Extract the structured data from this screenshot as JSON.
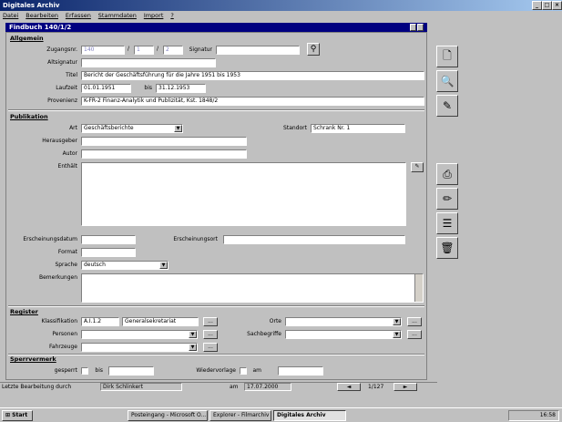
{
  "app_title": "Digitales Archiv",
  "menu": [
    "Datei",
    "Bearbeiten",
    "Erfassen",
    "Stammdaten",
    "Import",
    "?"
  ],
  "window_title": "Findbuch 140/1/2",
  "allgemein": {
    "heading": "Allgemein",
    "zugangsnr_label": "Zugangsnr.",
    "zugangsnr": [
      "140",
      "1",
      "2"
    ],
    "signatur_label": "Signatur",
    "signatur": "",
    "altsignatur_label": "Altsignatur",
    "altsignatur": "",
    "titel_label": "Titel",
    "titel": "Bericht der Geschäftsführung für die Jahre 1951 bis 1953",
    "laufzeit_label": "Laufzeit",
    "laufzeit_from": "01.01.1951",
    "bis_label": "bis",
    "laufzeit_to": "31.12.1953",
    "provenienz_label": "Provenienz",
    "provenienz": "K-FR-2 Finanz-Analytik und Publizität, Kst. 1848/2"
  },
  "publikation": {
    "heading": "Publikation",
    "art_label": "Art",
    "art": "Geschäftsberichte",
    "standort_label": "Standort",
    "standort": "Schrank Nr. 1",
    "herausgeber_label": "Herausgeber",
    "autor_label": "Autor",
    "enthaelt_label": "Enthält",
    "erscheinungsdatum_label": "Erscheinungsdatum",
    "erscheinungsort_label": "Erscheinungsort",
    "format_label": "Format",
    "sprache_label": "Sprache",
    "sprache": "deutsch",
    "bemerkungen_label": "Bemerkungen"
  },
  "register": {
    "heading": "Register",
    "klassifikation_label": "Klassifikation",
    "klassifikation_code": "A.I.1.2",
    "klassifikation_text": "Generalsekretariat",
    "personen_label": "Personen",
    "fahrzeuge_label": "Fahrzeuge",
    "orte_label": "Orte",
    "sachbegriffe_label": "Sachbegriffe",
    "ellipsis": "..."
  },
  "sperrvermerk": {
    "heading": "Sperrvermerk",
    "gesperrt_label": "gesperrt",
    "bis_label": "bis",
    "wiedervorlage_label": "Wiedervorlage",
    "am_label": "am"
  },
  "status": {
    "letzte_label": "Letzte Bearbeitung durch",
    "user": "Dirk Schlinkert",
    "am_label": "am",
    "date": "17.07.2000",
    "record": "1/127"
  },
  "taskbar": {
    "start": "Start",
    "items": [
      "Posteingang - Microsoft O...",
      "Explorer - Filmarchiv",
      "Digitales Archiv"
    ],
    "clock": "16:58"
  }
}
